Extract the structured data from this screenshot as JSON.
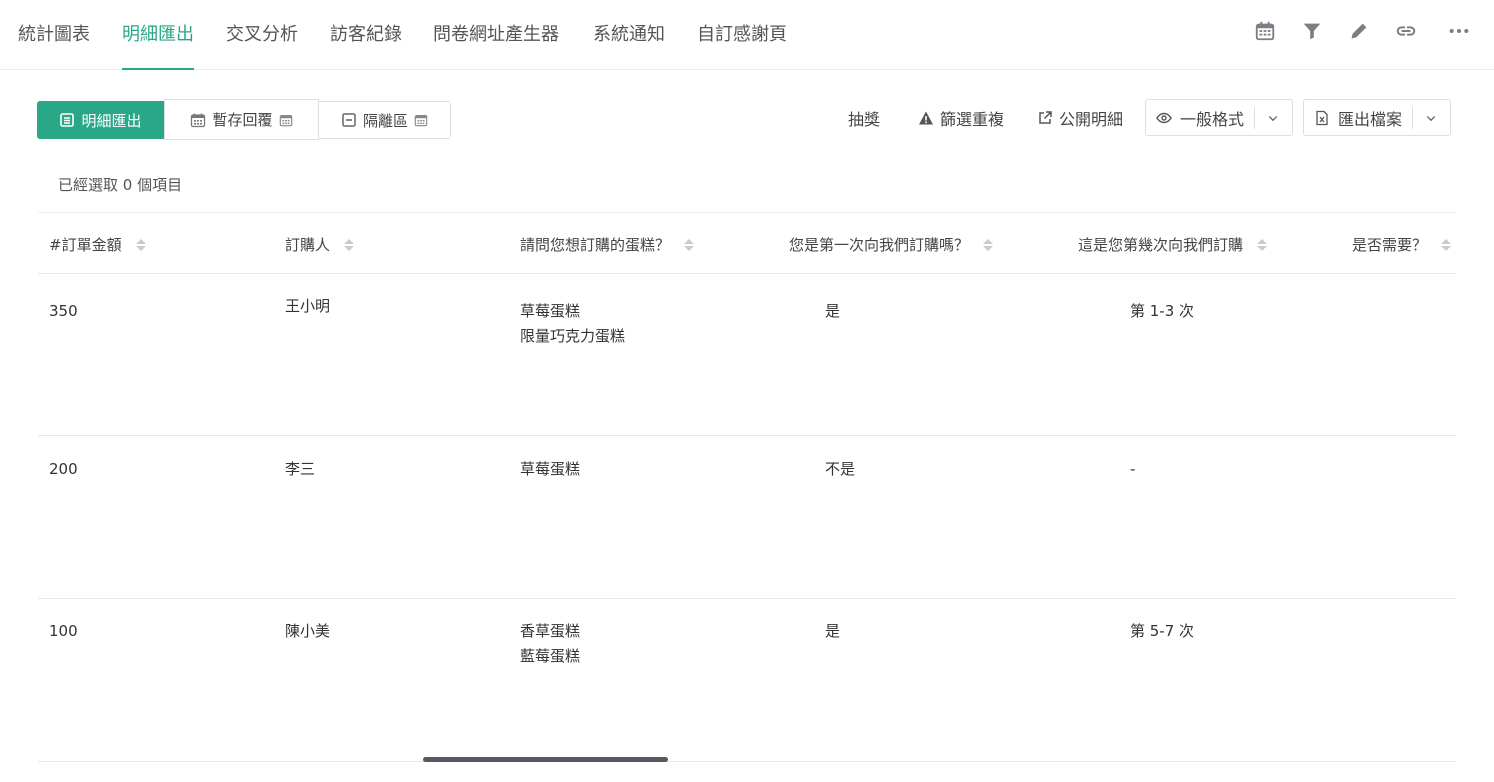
{
  "nav": {
    "tabs": [
      {
        "label": "統計圖表"
      },
      {
        "label": "明細匯出"
      },
      {
        "label": "交叉分析"
      },
      {
        "label": "訪客紀錄"
      },
      {
        "label": "問卷網址產生器"
      },
      {
        "label": "系統通知"
      },
      {
        "label": "自訂感謝頁"
      }
    ],
    "active_tab": "明細匯出",
    "icons": [
      "calendar-icon",
      "filter-icon",
      "pencil-icon",
      "link-icon",
      "more-icon"
    ]
  },
  "toolbar": {
    "detail_export": "明細匯出",
    "saved_replies": "暫存回覆",
    "quarantine": "隔離區",
    "lottery": "抽獎",
    "filter_duplicates": "篩選重複",
    "public_detail": "公開明細",
    "format": "一般格式",
    "export_file": "匯出檔案"
  },
  "selection": "已經選取 0 個項目",
  "table": {
    "columns": [
      "#訂單金額",
      "訂購人",
      "請問您想訂購的蛋糕？",
      "您是第一次向我們訂購嗎？",
      "這是您第幾次向我們訂購",
      "是否需要？"
    ],
    "rows": [
      {
        "amount": "350",
        "buyer": "王小明",
        "cake_1": "草莓蛋糕",
        "cake_2": "限量巧克力蛋糕",
        "first_time": "是",
        "times": "第 1-3 次"
      },
      {
        "amount": "200",
        "buyer": "李三",
        "cake_1": "草莓蛋糕",
        "cake_2": "",
        "first_time": "不是",
        "times": "-"
      },
      {
        "amount": "100",
        "buyer": "陳小美",
        "cake_1": "香草蛋糕",
        "cake_2": "藍莓蛋糕",
        "first_time": "是",
        "times": "第 5-7 次"
      }
    ]
  },
  "colors": {
    "accent": "#2aa786"
  }
}
